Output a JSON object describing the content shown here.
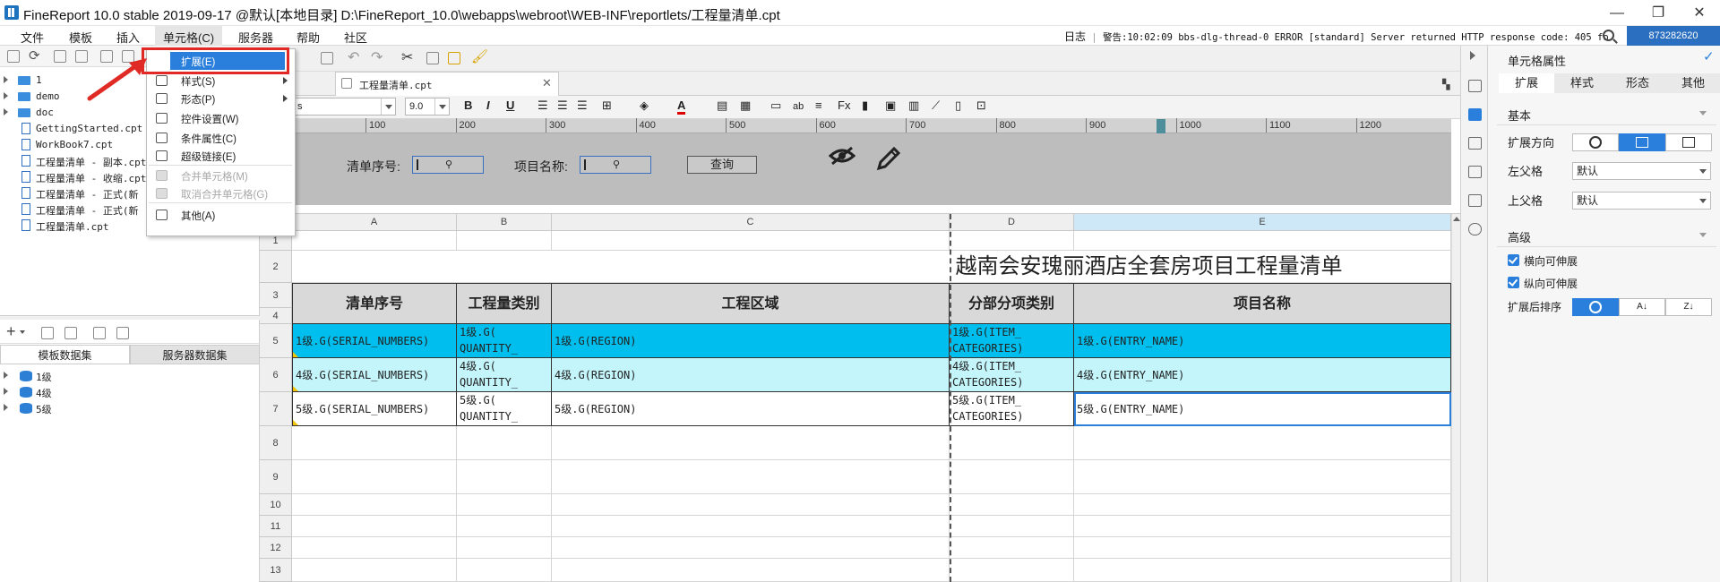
{
  "titlebar": {
    "title": "FineReport 10.0 stable 2019-09-17 @默认[本地目录]    D:\\FineReport_10.0\\webapps\\webroot\\WEB-INF\\reportlets/工程量清单.cpt"
  },
  "menubar": {
    "items": [
      "文件",
      "模板",
      "插入",
      "单元格(C)",
      "服务器",
      "帮助",
      "社区"
    ],
    "log_label": "日志",
    "log_message": "警告:10:02:09 bbs-dlg-thread-0 ERROR [standard] Server returned HTTP response code: 405 fo",
    "user_id": "873282620"
  },
  "file_tree": {
    "items": [
      {
        "type": "folder",
        "label": "1"
      },
      {
        "type": "folder",
        "label": "demo"
      },
      {
        "type": "folder",
        "label": "doc"
      },
      {
        "type": "file",
        "label": "GettingStarted.cpt"
      },
      {
        "type": "file",
        "label": "WorkBook7.cpt"
      },
      {
        "type": "file",
        "label": "工程量清单 - 副本.cpt"
      },
      {
        "type": "file",
        "label": "工程量清单 - 收缩.cpt"
      },
      {
        "type": "file",
        "label": "工程量清单 - 正式(新"
      },
      {
        "type": "file",
        "label": "工程量清单 - 正式(新"
      },
      {
        "type": "file",
        "label": "工程量清单.cpt"
      }
    ]
  },
  "dataset_panel": {
    "tabs": [
      "模板数据集",
      "服务器数据集"
    ],
    "items": [
      "1级",
      "4级",
      "5级"
    ]
  },
  "cell_menu": {
    "items": [
      {
        "label": "扩展(E)",
        "disabled": false,
        "submenu": false
      },
      {
        "label": "样式(S)",
        "disabled": false,
        "submenu": true
      },
      {
        "label": "形态(P)",
        "disabled": false,
        "submenu": true
      },
      {
        "label": "控件设置(W)",
        "disabled": false,
        "submenu": false
      },
      {
        "label": "条件属性(C)",
        "disabled": false,
        "submenu": false
      },
      {
        "label": "超级链接(E)",
        "disabled": false,
        "submenu": false
      },
      {
        "label": "合并单元格(M)",
        "disabled": true,
        "submenu": false
      },
      {
        "label": "取消合并单元格(G)",
        "disabled": true,
        "submenu": false
      },
      {
        "label": "其他(A)",
        "disabled": false,
        "submenu": false
      }
    ]
  },
  "editor": {
    "tab_label": "工程量清单.cpt",
    "font_name": "s",
    "font_size": "9.0"
  },
  "ruler": {
    "labels": [
      "100",
      "200",
      "300",
      "400",
      "500",
      "600",
      "700",
      "800",
      "900",
      "1000",
      "1100",
      "1200"
    ]
  },
  "param_panel": {
    "label1": "清单序号:",
    "label2": "项目名称:",
    "query_button": "查询"
  },
  "sheet": {
    "columns": [
      "A",
      "B",
      "C",
      "D",
      "E"
    ],
    "rows": [
      "1",
      "2",
      "3",
      "4",
      "5",
      "6",
      "7",
      "8",
      "9",
      "10",
      "11",
      "12",
      "13"
    ],
    "title": "越南会安瑰丽酒店全套房项目工程量清单",
    "headers": [
      "清单序号",
      "工程量类别",
      "工程区域",
      "分部分项类别",
      "项目名称"
    ],
    "data_rows": [
      {
        "color": "#00bfee",
        "cells": [
          "1级.G(SERIAL_NUMBERS)",
          "1级.G(\nQUANTITY_",
          "1级.G(REGION)",
          "1级.G(ITEM_\nCATEGORIES)",
          "1级.G(ENTRY_NAME)"
        ]
      },
      {
        "color": "#c3f5fb",
        "cells": [
          "4级.G(SERIAL_NUMBERS)",
          "4级.G(\nQUANTITY_",
          "4级.G(REGION)",
          "4级.G(ITEM_\nCATEGORIES)",
          "4级.G(ENTRY_NAME)"
        ]
      },
      {
        "color": "#ffffff",
        "cells": [
          "5级.G(SERIAL_NUMBERS)",
          "5级.G(\nQUANTITY_",
          "5级.G(REGION)",
          "5级.G(ITEM_\nCATEGORIES)",
          "5级.G(ENTRY_NAME)"
        ]
      }
    ]
  },
  "property_panel": {
    "title": "单元格属性",
    "tabs": [
      "扩展",
      "样式",
      "形态",
      "其他"
    ],
    "section_basic": "基本",
    "expand_direction_label": "扩展方向",
    "left_parent_label": "左父格",
    "left_parent_value": "默认",
    "top_parent_label": "上父格",
    "top_parent_value": "默认",
    "section_advanced": "高级",
    "horizontal_expand": "横向可伸展",
    "vertical_expand": "纵向可伸展",
    "sort_label": "扩展后排序"
  },
  "colors": {
    "accent": "#2b7fdc",
    "highlight_red": "#e02a25",
    "row_cyan": "#00bfee",
    "row_light": "#c3f5fb"
  }
}
